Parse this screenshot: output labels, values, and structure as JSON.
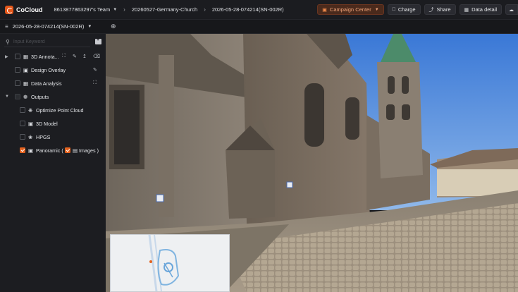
{
  "app": {
    "name": "CoCloud"
  },
  "breadcrumb": {
    "team": "8613877863297's Team",
    "project": "20260527-Germany-Church",
    "task": "2026-05-28-074214(SN-002R)"
  },
  "toolbar": {
    "campaign_label": "Campaign Center",
    "charge_label": "Charge",
    "share_label": "Share",
    "data_detail_label": "Data detail"
  },
  "subbar": {
    "title": "2026-05-28-074214(SN-002R)"
  },
  "search": {
    "placeholder": "Input Keyword",
    "value": ""
  },
  "layers": {
    "annotation": "3D Annota...",
    "design_overlay": "Design Overlay",
    "data_analysis": "Data Analysis",
    "outputs": "Outputs",
    "point_cloud": "Optimize Point Cloud",
    "model": "3D Model",
    "hpgs": "HPGS",
    "panoramic_prefix": "Panoramic (",
    "panoramic_images": "Images )"
  },
  "icons": {
    "logo": "cocloud-logo",
    "campaign": "gift-icon",
    "charge": "wallet-icon",
    "share": "share-icon",
    "data_detail": "table-icon",
    "upload": "cloud-upload-icon",
    "layers": "layers-icon",
    "target": "crosshair-icon",
    "search": "search-icon",
    "folder_add": "folder-add-icon"
  },
  "colors": {
    "accent": "#e4621e",
    "topbar_bg": "#1b1c20",
    "sidebar_bg": "#1c1d21",
    "campaign_bg": "#4a2a1c"
  }
}
